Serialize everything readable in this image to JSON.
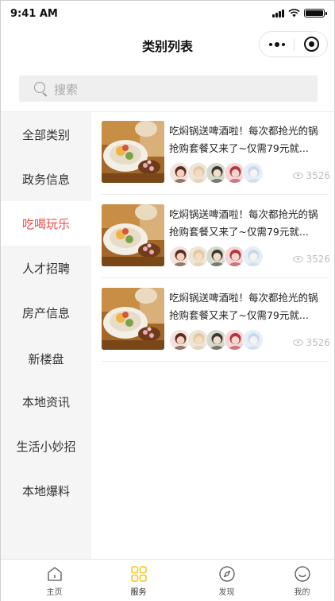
{
  "status_bar": {
    "time": "9:41 AM",
    "battery_level": 0.92
  },
  "nav": {
    "title": "类别列表",
    "more_icon": "more-dots-icon",
    "close_icon": "target-close-icon"
  },
  "search": {
    "placeholder": "搜索",
    "icon": "search-icon"
  },
  "sidebar": {
    "active_index": 2,
    "active_color": "#e94b4b",
    "items": [
      {
        "label": "全部类别"
      },
      {
        "label": "政务信息"
      },
      {
        "label": "吃喝玩乐"
      },
      {
        "label": "人才招聘"
      },
      {
        "label": "房产信息"
      },
      {
        "label": "新楼盘"
      },
      {
        "label": "本地资讯"
      },
      {
        "label": "生活小妙招"
      },
      {
        "label": "本地爆料"
      }
    ]
  },
  "posts": [
    {
      "title_line1": "吃焖锅送啤酒啦！每次都抢光的锅",
      "title_line2": "抢购套餐又来了~仅需79元就...",
      "views": "3526",
      "avatar_count": 5
    },
    {
      "title_line1": "吃焖锅送啤酒啦！每次都抢光的锅",
      "title_line2": "抢购套餐又来了~仅需79元就...",
      "views": "3526",
      "avatar_count": 5
    },
    {
      "title_line1": "吃焖锅送啤酒啦！每次都抢光的锅",
      "title_line2": "抢购套餐又来了~仅需79元就...",
      "views": "3526",
      "avatar_count": 5
    }
  ],
  "tab_bar": {
    "active_index": 1,
    "active_color": "#f5c518",
    "tabs": [
      {
        "label": "主页",
        "icon": "home-icon"
      },
      {
        "label": "服务",
        "icon": "grid-icon"
      },
      {
        "label": "发现",
        "icon": "compass-icon"
      },
      {
        "label": "我的",
        "icon": "smile-icon"
      }
    ]
  }
}
